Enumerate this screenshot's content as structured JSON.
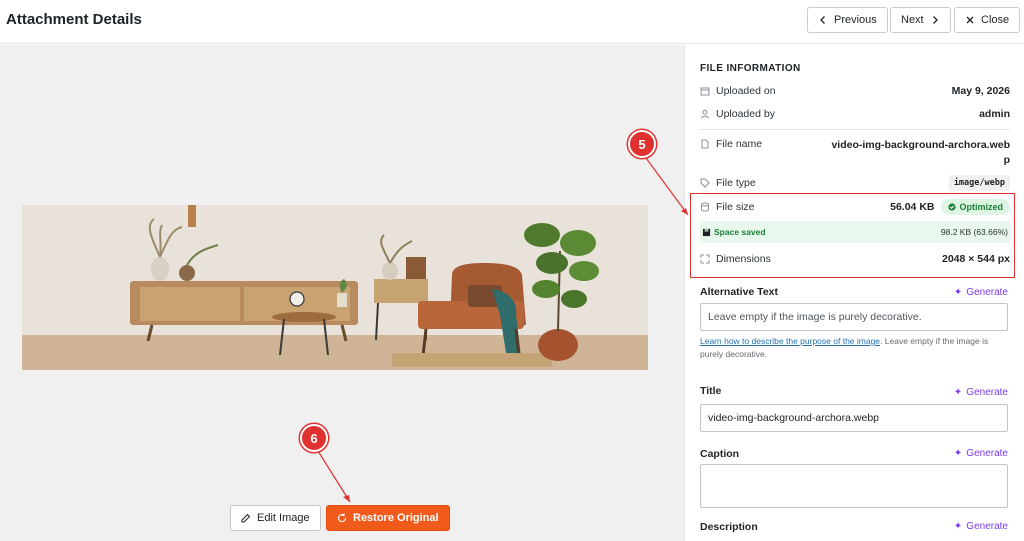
{
  "header": {
    "title": "Attachment Details",
    "previous_label": "Previous",
    "next_label": "Next",
    "close_label": "Close"
  },
  "file_info": {
    "heading": "FILE INFORMATION",
    "uploaded_on_label": "Uploaded on",
    "uploaded_on_value": "May 9, 2026",
    "uploaded_by_label": "Uploaded by",
    "uploaded_by_value": "admin",
    "file_name_label": "File name",
    "file_name_line1": "video-img-background-archora.web",
    "file_name_line2": "p",
    "file_type_label": "File type",
    "file_type_value": "image/webp",
    "file_size_label": "File size",
    "file_size_value": "56.04 KB",
    "optimized_badge": "Optimized",
    "space_saved_label": "Space saved",
    "space_saved_value": "98.2 KB (63.66%)",
    "dimensions_label": "Dimensions",
    "dimensions_value": "2048 × 544 px"
  },
  "fields": {
    "alt_label": "Alternative Text",
    "alt_placeholder": "Leave empty if the image is purely decorative.",
    "help_link": "Learn how to describe the purpose of the image",
    "help_rest": ". Leave empty if the image is purely decorative.",
    "title_label": "Title",
    "title_value": "video-img-background-archora.webp",
    "caption_label": "Caption",
    "description_label": "Description",
    "generate_label": "Generate"
  },
  "actions": {
    "edit_image": "Edit Image",
    "restore_original": "Restore Original"
  },
  "markers": {
    "five": "5",
    "six": "6"
  },
  "colors": {
    "accent": "#f05a1a",
    "highlight": "#e03131",
    "generate": "#7c3aed",
    "success": "#1a7f37"
  }
}
